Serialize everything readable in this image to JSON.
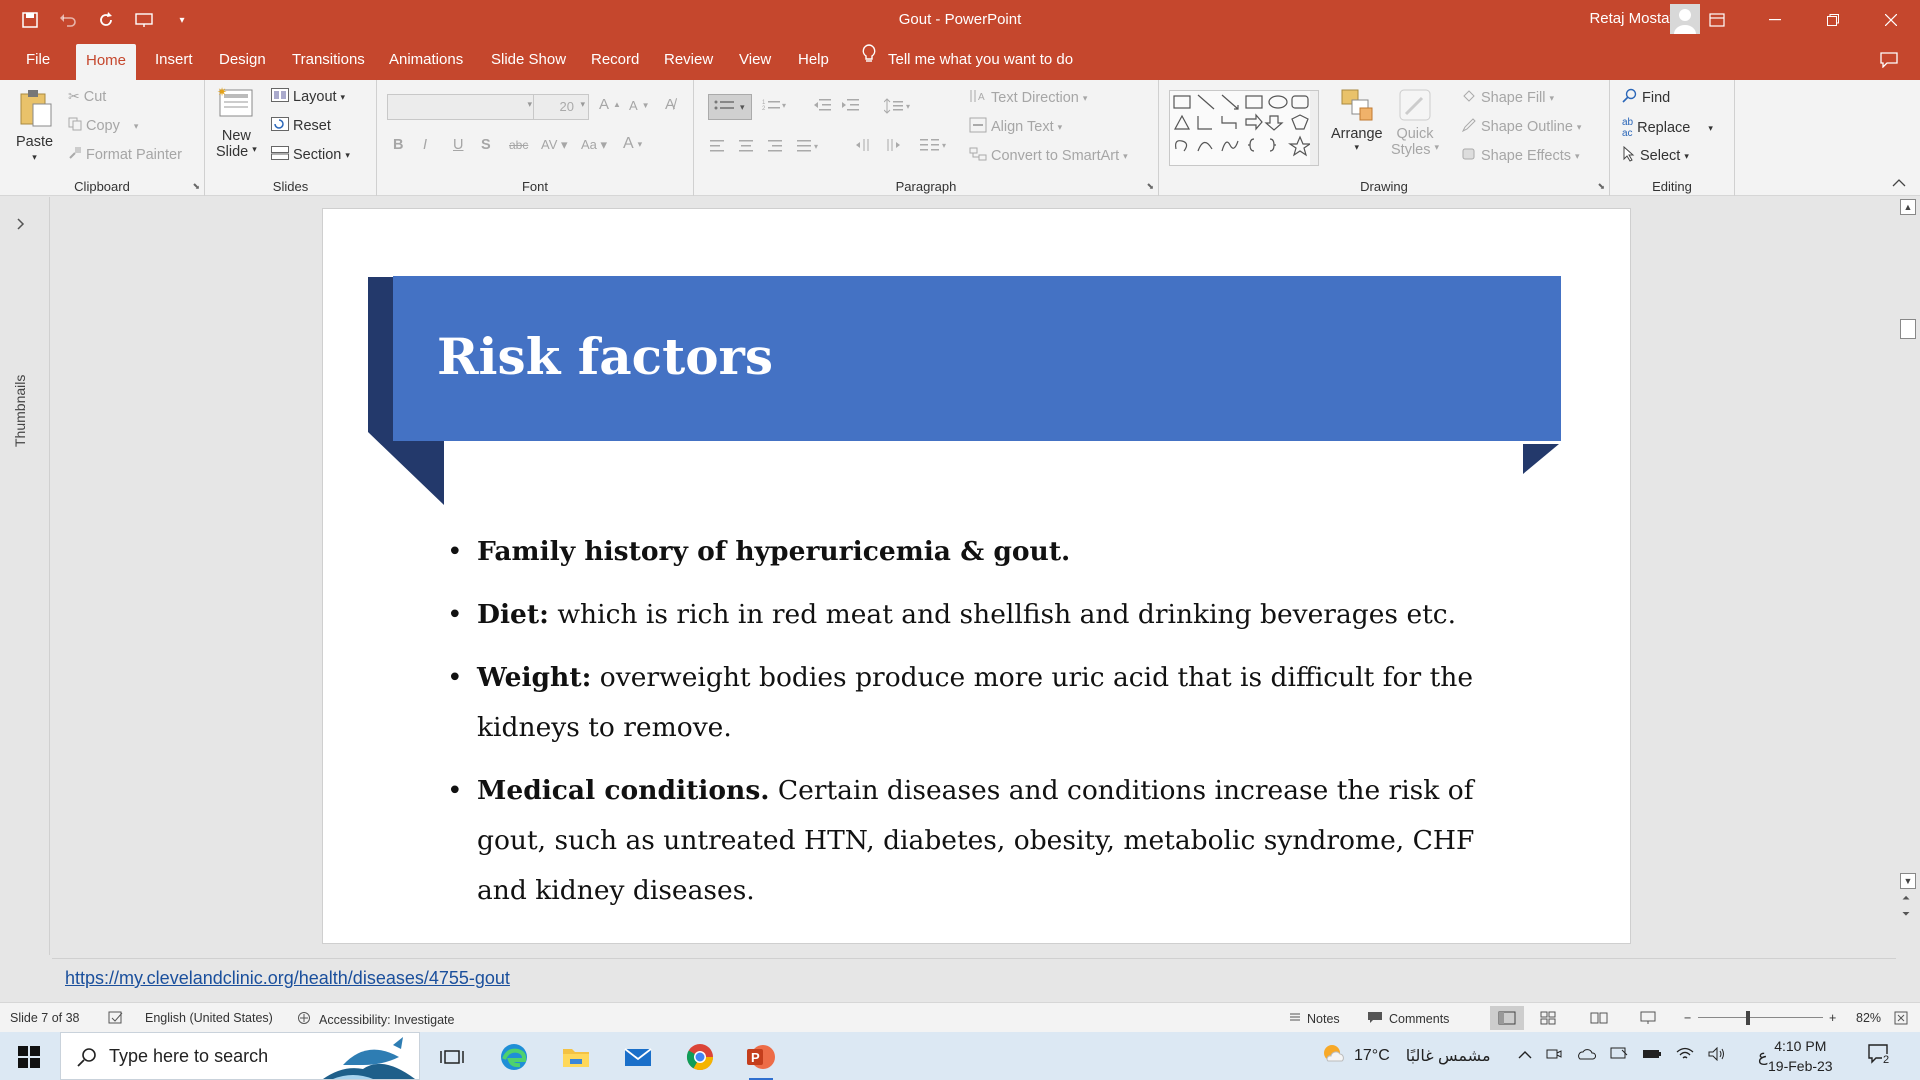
{
  "window": {
    "title": "Gout  -  PowerPoint",
    "user_name": "Retaj Mostafa"
  },
  "tabs": [
    {
      "label": "File"
    },
    {
      "label": "Home",
      "active": true
    },
    {
      "label": "Insert"
    },
    {
      "label": "Design"
    },
    {
      "label": "Transitions"
    },
    {
      "label": "Animations"
    },
    {
      "label": "Slide Show"
    },
    {
      "label": "Record"
    },
    {
      "label": "Review"
    },
    {
      "label": "View"
    },
    {
      "label": "Help"
    }
  ],
  "tell_me": "Tell me what you want to do",
  "ribbon": {
    "clipboard": {
      "label": "Clipboard",
      "paste": "Paste",
      "cut": "Cut",
      "copy": "Copy",
      "format_painter": "Format Painter"
    },
    "slides": {
      "label": "Slides",
      "new_slide_1": "New",
      "new_slide_2": "Slide",
      "layout": "Layout",
      "reset": "Reset",
      "section": "Section"
    },
    "font": {
      "label": "Font",
      "size": "20"
    },
    "paragraph": {
      "label": "Paragraph",
      "text_direction": "Text Direction",
      "align_text": "Align Text",
      "convert_smartart": "Convert to SmartArt"
    },
    "drawing": {
      "label": "Drawing",
      "arrange": "Arrange",
      "quick_styles_1": "Quick",
      "quick_styles_2": "Styles",
      "shape_fill": "Shape Fill",
      "shape_outline": "Shape Outline",
      "shape_effects": "Shape Effects"
    },
    "editing": {
      "label": "Editing",
      "find": "Find",
      "replace": "Replace",
      "select": "Select"
    }
  },
  "thumbnails_label": "Thumbnails",
  "slide": {
    "title": "Risk factors",
    "bullets": [
      {
        "bold": "Family history of hyperuricemia & gout.",
        "text": ""
      },
      {
        "bold": "Diet:",
        "text": " which is rich in red meat and shellfish and drinking beverages etc."
      },
      {
        "bold": "Weight:",
        "text": " overweight bodies produce more uric acid that is difficult for the kidneys to remove."
      },
      {
        "bold": "Medical conditions.",
        "text": " Certain diseases and conditions increase the risk of gout, such as untreated HTN, diabetes, obesity, metabolic syndrome, CHF and kidney diseases."
      }
    ]
  },
  "notes": {
    "link": "https://my.clevelandclinic.org/health/diseases/4755-gout"
  },
  "status": {
    "slide_counter": "Slide 7 of 38",
    "language": "English (United States)",
    "accessibility": "Accessibility: Investigate",
    "notes": "Notes",
    "comments": "Comments",
    "zoom": "82%"
  },
  "taskbar": {
    "search_placeholder": "Type here to search",
    "weather_temp": "17°C",
    "weather_desc": "مشمس غالبًا",
    "lang": "ع",
    "time": "4:10 PM",
    "date": "19-Feb-23",
    "notif_count": "2"
  },
  "colors": {
    "ppt_red": "#c5472d",
    "banner_blue": "#4472c4",
    "banner_dark": "#23396b"
  }
}
